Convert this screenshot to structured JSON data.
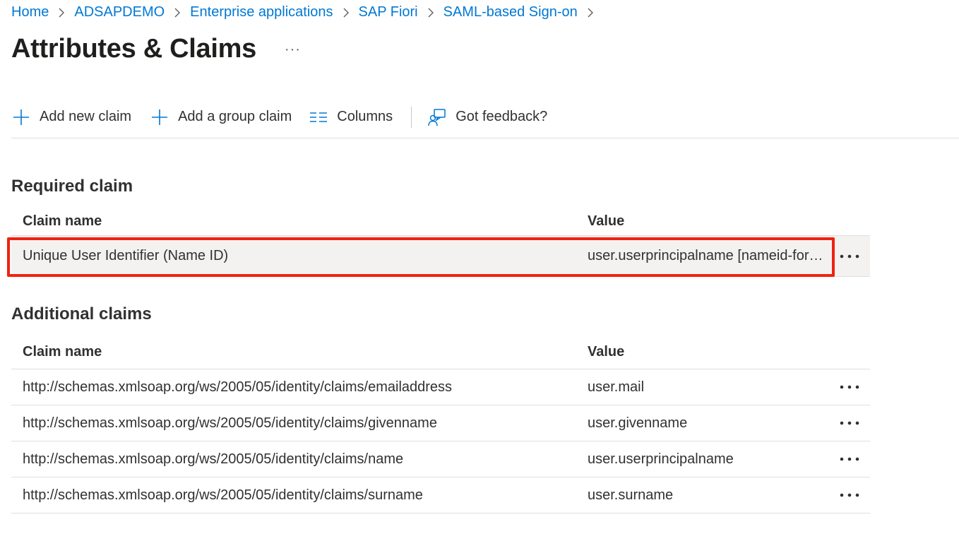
{
  "breadcrumb": [
    "Home",
    "ADSAPDEMO",
    "Enterprise applications",
    "SAP Fiori",
    "SAML-based Sign-on"
  ],
  "page": {
    "title": "Attributes & Claims",
    "more_label": "···"
  },
  "toolbar": {
    "add_claim": "Add new claim",
    "add_group_claim": "Add a group claim",
    "columns": "Columns",
    "feedback": "Got feedback?"
  },
  "required": {
    "title": "Required claim",
    "headers": {
      "name": "Claim name",
      "value": "Value"
    },
    "rows": [
      {
        "name": "Unique User Identifier (Name ID)",
        "value": "user.userprincipalname [nameid-format:emailAddress]"
      }
    ]
  },
  "additional": {
    "title": "Additional claims",
    "headers": {
      "name": "Claim name",
      "value": "Value"
    },
    "rows": [
      {
        "name": "http://schemas.xmlsoap.org/ws/2005/05/identity/claims/emailaddress",
        "value": "user.mail"
      },
      {
        "name": "http://schemas.xmlsoap.org/ws/2005/05/identity/claims/givenname",
        "value": "user.givenname"
      },
      {
        "name": "http://schemas.xmlsoap.org/ws/2005/05/identity/claims/name",
        "value": "user.userprincipalname"
      },
      {
        "name": "http://schemas.xmlsoap.org/ws/2005/05/identity/claims/surname",
        "value": "user.surname"
      }
    ]
  },
  "icons": {
    "breadcrumb_separator": "chevron-right-icon",
    "add": "plus-icon",
    "columns": "columns-icon",
    "feedback": "feedback-icon",
    "row_more": "more-horizontal-icon"
  },
  "colors": {
    "link": "#0078d4",
    "highlight": "#f0220f",
    "selected_row": "#f3f2f1"
  }
}
